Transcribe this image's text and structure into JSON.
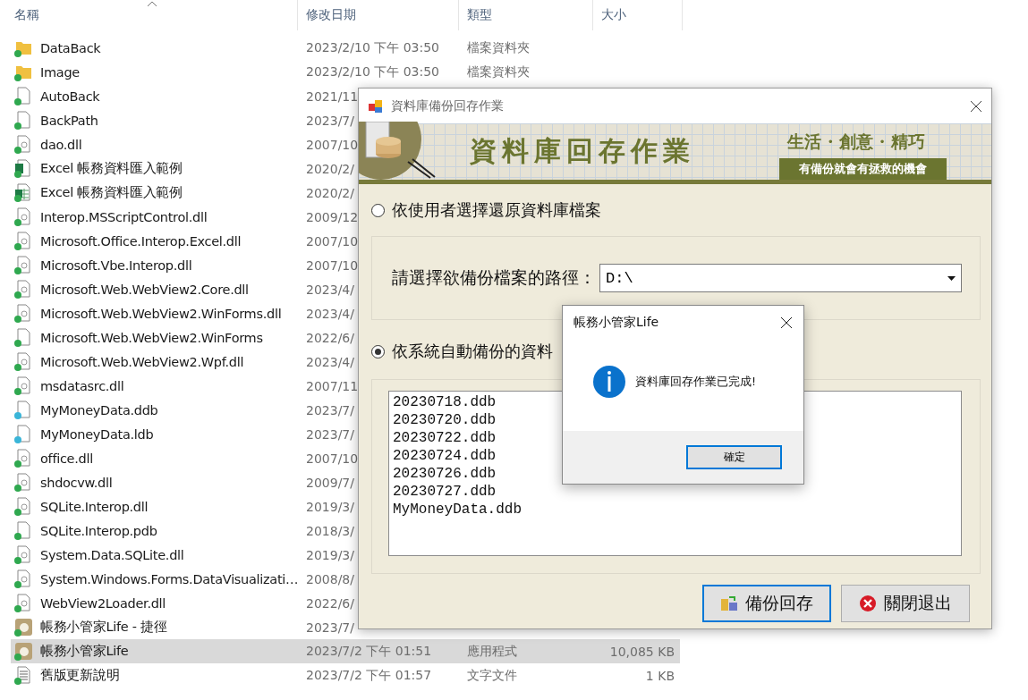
{
  "explorer": {
    "columns": [
      {
        "label": "名稱",
        "sorted": true
      },
      {
        "label": "修改日期",
        "sorted": false
      },
      {
        "label": "類型",
        "sorted": false
      },
      {
        "label": "大小",
        "sorted": false
      }
    ],
    "rows": [
      {
        "kind": "folder",
        "synced": true,
        "selected": false,
        "name": "DataBack",
        "date": "2023/2/10 下午 03:50",
        "type": "檔案資料夾"
      },
      {
        "kind": "folder",
        "synced": true,
        "selected": false,
        "name": "Image",
        "date": "2023/2/10 下午 03:50",
        "type": "檔案資料夾"
      },
      {
        "kind": "file",
        "synced": true,
        "selected": false,
        "name": "AutoBack",
        "date": "2021/11"
      },
      {
        "kind": "file",
        "synced": true,
        "selected": false,
        "name": "BackPath",
        "date": "2023/7/"
      },
      {
        "kind": "dll",
        "synced": true,
        "selected": false,
        "name": "dao.dll",
        "date": "2007/10"
      },
      {
        "kind": "excel",
        "synced": true,
        "selected": false,
        "name": "Excel 帳務資料匯入範例",
        "date": "2020/2/"
      },
      {
        "kind": "sheet",
        "synced": true,
        "selected": false,
        "name": "Excel 帳務資料匯入範例",
        "date": "2020/2/"
      },
      {
        "kind": "dll",
        "synced": true,
        "selected": false,
        "name": "Interop.MSScriptControl.dll",
        "date": "2009/12"
      },
      {
        "kind": "dll",
        "synced": true,
        "selected": false,
        "name": "Microsoft.Office.Interop.Excel.dll",
        "date": "2007/10"
      },
      {
        "kind": "dll",
        "synced": true,
        "selected": false,
        "name": "Microsoft.Vbe.Interop.dll",
        "date": "2007/10"
      },
      {
        "kind": "dll",
        "synced": true,
        "selected": false,
        "name": "Microsoft.Web.WebView2.Core.dll",
        "date": "2023/4/"
      },
      {
        "kind": "dll",
        "synced": true,
        "selected": false,
        "name": "Microsoft.Web.WebView2.WinForms.dll",
        "date": "2023/4/"
      },
      {
        "kind": "file",
        "synced": true,
        "selected": false,
        "name": "Microsoft.Web.WebView2.WinForms",
        "date": "2022/6/"
      },
      {
        "kind": "dll",
        "synced": true,
        "selected": false,
        "name": "Microsoft.Web.WebView2.Wpf.dll",
        "date": "2023/4/"
      },
      {
        "kind": "dll",
        "synced": true,
        "selected": false,
        "name": "msdatasrc.dll",
        "date": "2007/11"
      },
      {
        "kind": "file",
        "synced": false,
        "selected": false,
        "name": "MyMoneyData.ddb",
        "date": "2023/7/"
      },
      {
        "kind": "file",
        "synced": false,
        "selected": false,
        "name": "MyMoneyData.ldb",
        "date": "2023/7/"
      },
      {
        "kind": "dll",
        "synced": true,
        "selected": false,
        "name": "office.dll",
        "date": "2007/10"
      },
      {
        "kind": "dll",
        "synced": true,
        "selected": false,
        "name": "shdocvw.dll",
        "date": "2009/7/"
      },
      {
        "kind": "dll",
        "synced": true,
        "selected": false,
        "name": "SQLite.Interop.dll",
        "date": "2019/3/"
      },
      {
        "kind": "file",
        "synced": true,
        "selected": false,
        "name": "SQLite.Interop.pdb",
        "date": "2018/3/"
      },
      {
        "kind": "dll",
        "synced": true,
        "selected": false,
        "name": "System.Data.SQLite.dll",
        "date": "2019/3/"
      },
      {
        "kind": "dll",
        "synced": true,
        "selected": false,
        "name": "System.Windows.Forms.DataVisualizati…",
        "date": "2008/8/"
      },
      {
        "kind": "dll",
        "synced": true,
        "selected": false,
        "name": "WebView2Loader.dll",
        "date": "2022/6/"
      },
      {
        "kind": "app",
        "synced": true,
        "selected": false,
        "name": "帳務小管家Life - 捷徑",
        "date": "2023/7/"
      },
      {
        "kind": "app",
        "synced": true,
        "selected": true,
        "name": "帳務小管家Life",
        "date": "2023/7/2 下午 01:51",
        "type": "應用程式",
        "size": "10,085 KB"
      },
      {
        "kind": "text",
        "synced": true,
        "selected": false,
        "name": "舊版更新說明",
        "date": "2023/7/2 下午 01:57",
        "type": "文字文件",
        "size": "1 KB"
      }
    ]
  },
  "dialog": {
    "title": "資料庫備份回存作業",
    "banner": {
      "heading": "資料庫回存作業",
      "tagline": "生活 · 創意 · 精巧",
      "slogan": "有備份就會有拯救的機會"
    },
    "options": [
      {
        "label": "依使用者選擇還原資料庫檔案",
        "selected": false
      },
      {
        "label": "依系統自動備份的資料",
        "selected": true
      }
    ],
    "path": {
      "label": "請選擇欲備份檔案的路徑：",
      "value": "D:\\"
    },
    "files": [
      "20230718.ddb",
      "20230720.ddb",
      "20230722.ddb",
      "20230724.ddb",
      "20230726.ddb",
      "20230727.ddb",
      "MyMoneyData.ddb"
    ],
    "buttons": [
      {
        "kind": "restore",
        "label": "備份回存",
        "focused": true
      },
      {
        "kind": "close",
        "label": "關閉退出",
        "focused": false
      }
    ]
  },
  "message_box": {
    "title": "帳務小管家Life",
    "message": "資料庫回存作業已完成!",
    "button": "確定"
  }
}
